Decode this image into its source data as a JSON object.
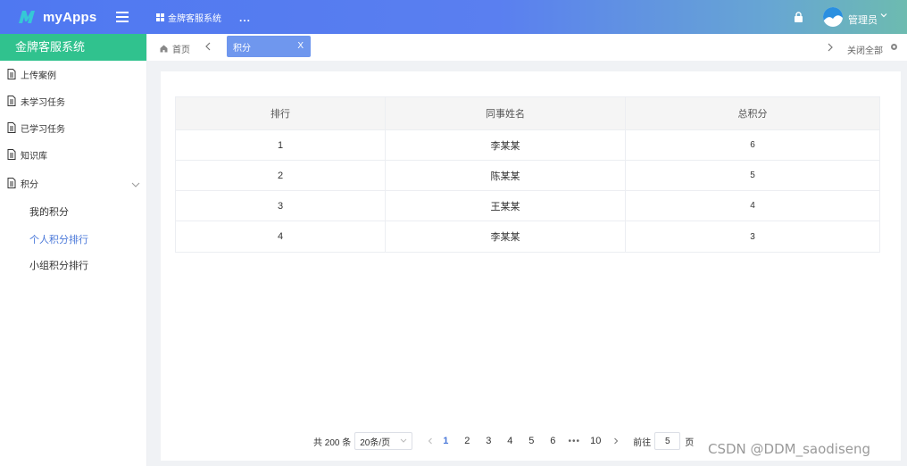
{
  "header": {
    "app_name": "myApps",
    "system_menu": "金牌客服系统",
    "more": "...",
    "user_name": "管理员"
  },
  "sidebar": {
    "title": "金牌客服系统",
    "items": [
      {
        "label": "上传案例"
      },
      {
        "label": "未学习任务"
      },
      {
        "label": "已学习任务"
      },
      {
        "label": "知识库"
      },
      {
        "label": "积分"
      }
    ],
    "sub_items": [
      {
        "label": "我的积分",
        "active": false
      },
      {
        "label": "个人积分排行",
        "active": true
      },
      {
        "label": "小组积分排行",
        "active": false
      }
    ]
  },
  "tabs": {
    "home": "首页",
    "active": "积分",
    "close_mark": "X",
    "close_all": "关闭全部"
  },
  "table": {
    "columns": [
      "排行",
      "同事姓名",
      "总积分"
    ],
    "rows": [
      [
        "1",
        "李某某",
        "6"
      ],
      [
        "2",
        "陈某某",
        "5"
      ],
      [
        "3",
        "王某某",
        "4"
      ],
      [
        "4",
        "李某某",
        "3"
      ]
    ]
  },
  "pagination": {
    "total": "共 200 条",
    "page_size": "20条/页",
    "pages": [
      "1",
      "2",
      "3",
      "4",
      "5",
      "6"
    ],
    "ellipsis": "•••",
    "last_page": "10",
    "current": "1",
    "goto_label": "前往",
    "goto_value": "5",
    "goto_suffix": "页"
  },
  "watermark": "CSDN @DDM_saodiseng",
  "colors": {
    "header_start": "#4f78f1",
    "header_end": "#6dbbb0",
    "sidebar_head": "#30c28e",
    "active_tab": "#6f97ee",
    "active_link": "#4a78d9"
  }
}
